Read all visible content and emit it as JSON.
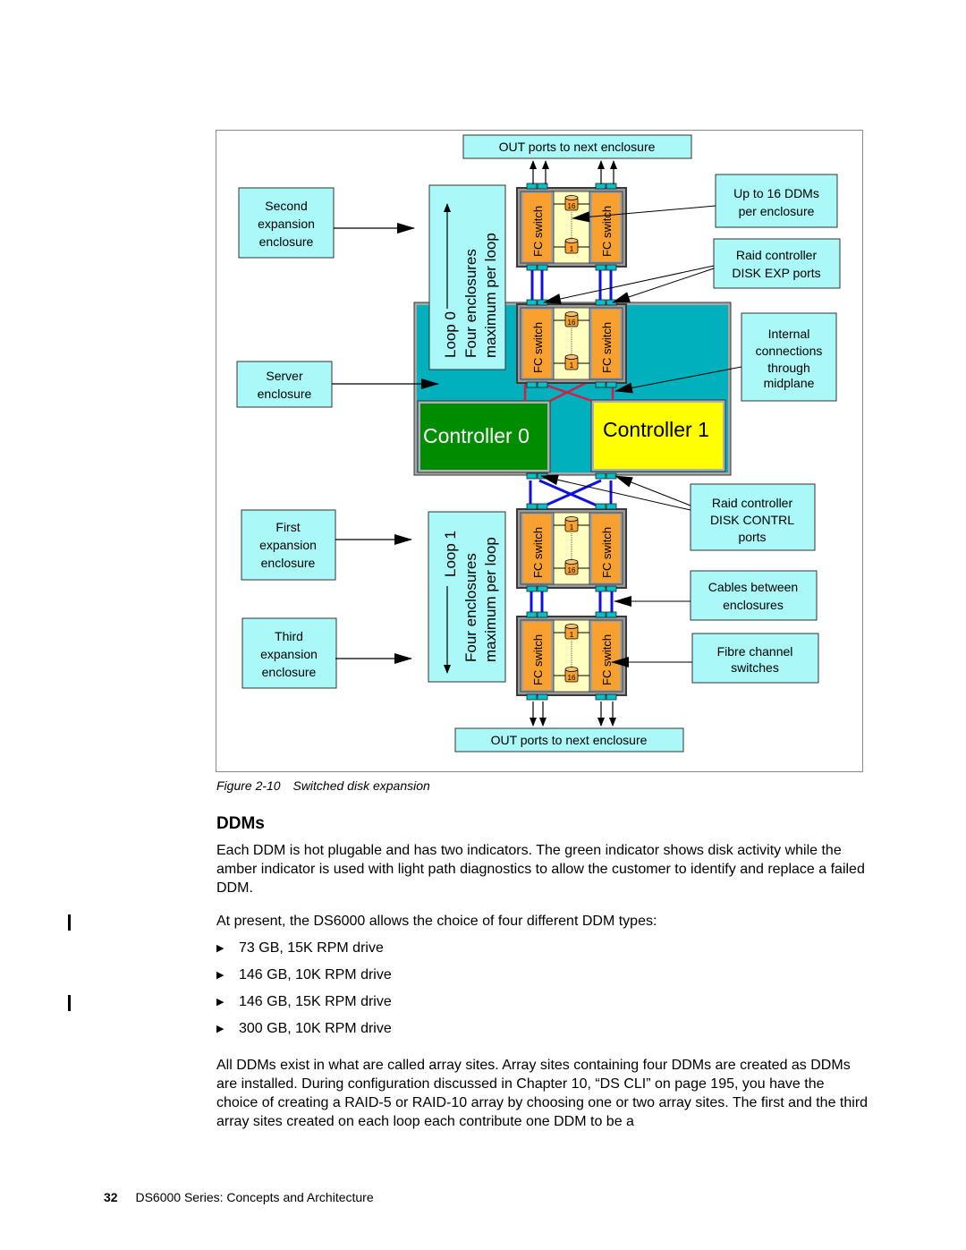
{
  "figure": {
    "top_out_ports": "OUT ports to next enclosure",
    "bottom_out_ports": "OUT ports to next enclosure",
    "left_labels": {
      "second_expansion": [
        "Second",
        "expansion",
        "enclosure"
      ],
      "server": [
        "Server",
        "enclosure"
      ],
      "first_expansion": [
        "First",
        "expansion",
        "enclosure"
      ],
      "third_expansion": [
        "Third",
        "expansion",
        "enclosure"
      ]
    },
    "right_labels": {
      "up_to_16": [
        "Up to 16 DDMs",
        "per enclosure"
      ],
      "disk_exp_ports": [
        "Raid controller",
        "DISK EXP ports"
      ],
      "internal_connections": [
        "Internal",
        "connections",
        "through",
        "midplane"
      ],
      "disk_contrl_ports": [
        "Raid controller",
        "DISK CONTRL",
        "ports"
      ],
      "cables_between": [
        "Cables between",
        "enclosures"
      ],
      "fibre_channel": [
        "Fibre channel",
        "switches"
      ]
    },
    "loop0": [
      "Loop 0",
      "Four enclosures",
      "maximum per loop"
    ],
    "loop1": [
      "Loop 1",
      "Four enclosures",
      "maximum per loop"
    ],
    "fc_switch_label": "FC switch",
    "disk_top_label": "16",
    "disk_bottom_label": "1",
    "controller0": "Controller 0",
    "controller1": "Controller 1",
    "colors": {
      "callout_fill": "#aaf8f8",
      "server_enclosure_fill": "#00b0bc",
      "controller0_fill": "#008c00",
      "controller1_fill": "#ffff00",
      "fc_switch_fill": "#f8a030",
      "drive_bay_fill": "#ffffc0",
      "enclosure_border": "#9a9a9a",
      "cable_blue": "#1010e0",
      "cable_red": "#d0204a",
      "port_fill": "#00c0c8"
    },
    "caption_number": "Figure 2-10",
    "caption_text": "Switched disk expansion"
  },
  "section": {
    "heading": "DDMs",
    "paragraph1": "Each DDM is hot plugable and has two indicators. The green indicator shows disk activity while the amber indicator is used with light path diagnostics to allow the customer to identify and replace a failed DDM.",
    "paragraph2": "At present, the DS6000 allows the choice of four different DDM types:",
    "ddm_types": [
      "73 GB, 15K RPM drive",
      "146 GB, 10K RPM drive",
      "146 GB, 15K RPM drive",
      "300 GB, 10K RPM drive"
    ],
    "bullet_icon": "▶",
    "paragraph3": "All DDMs exist in what are called array sites. Array sites containing four DDMs are created as DDMs are installed. During configuration discussed in Chapter 10, “DS CLI” on page 195, you have the choice of creating a RAID-5 or RAID-10 array by choosing one or two array sites. The first and the third array sites created on each loop each contribute one DDM to be a"
  },
  "footer": {
    "page_number": "32",
    "book_title": "DS6000 Series: Concepts and Architecture"
  }
}
